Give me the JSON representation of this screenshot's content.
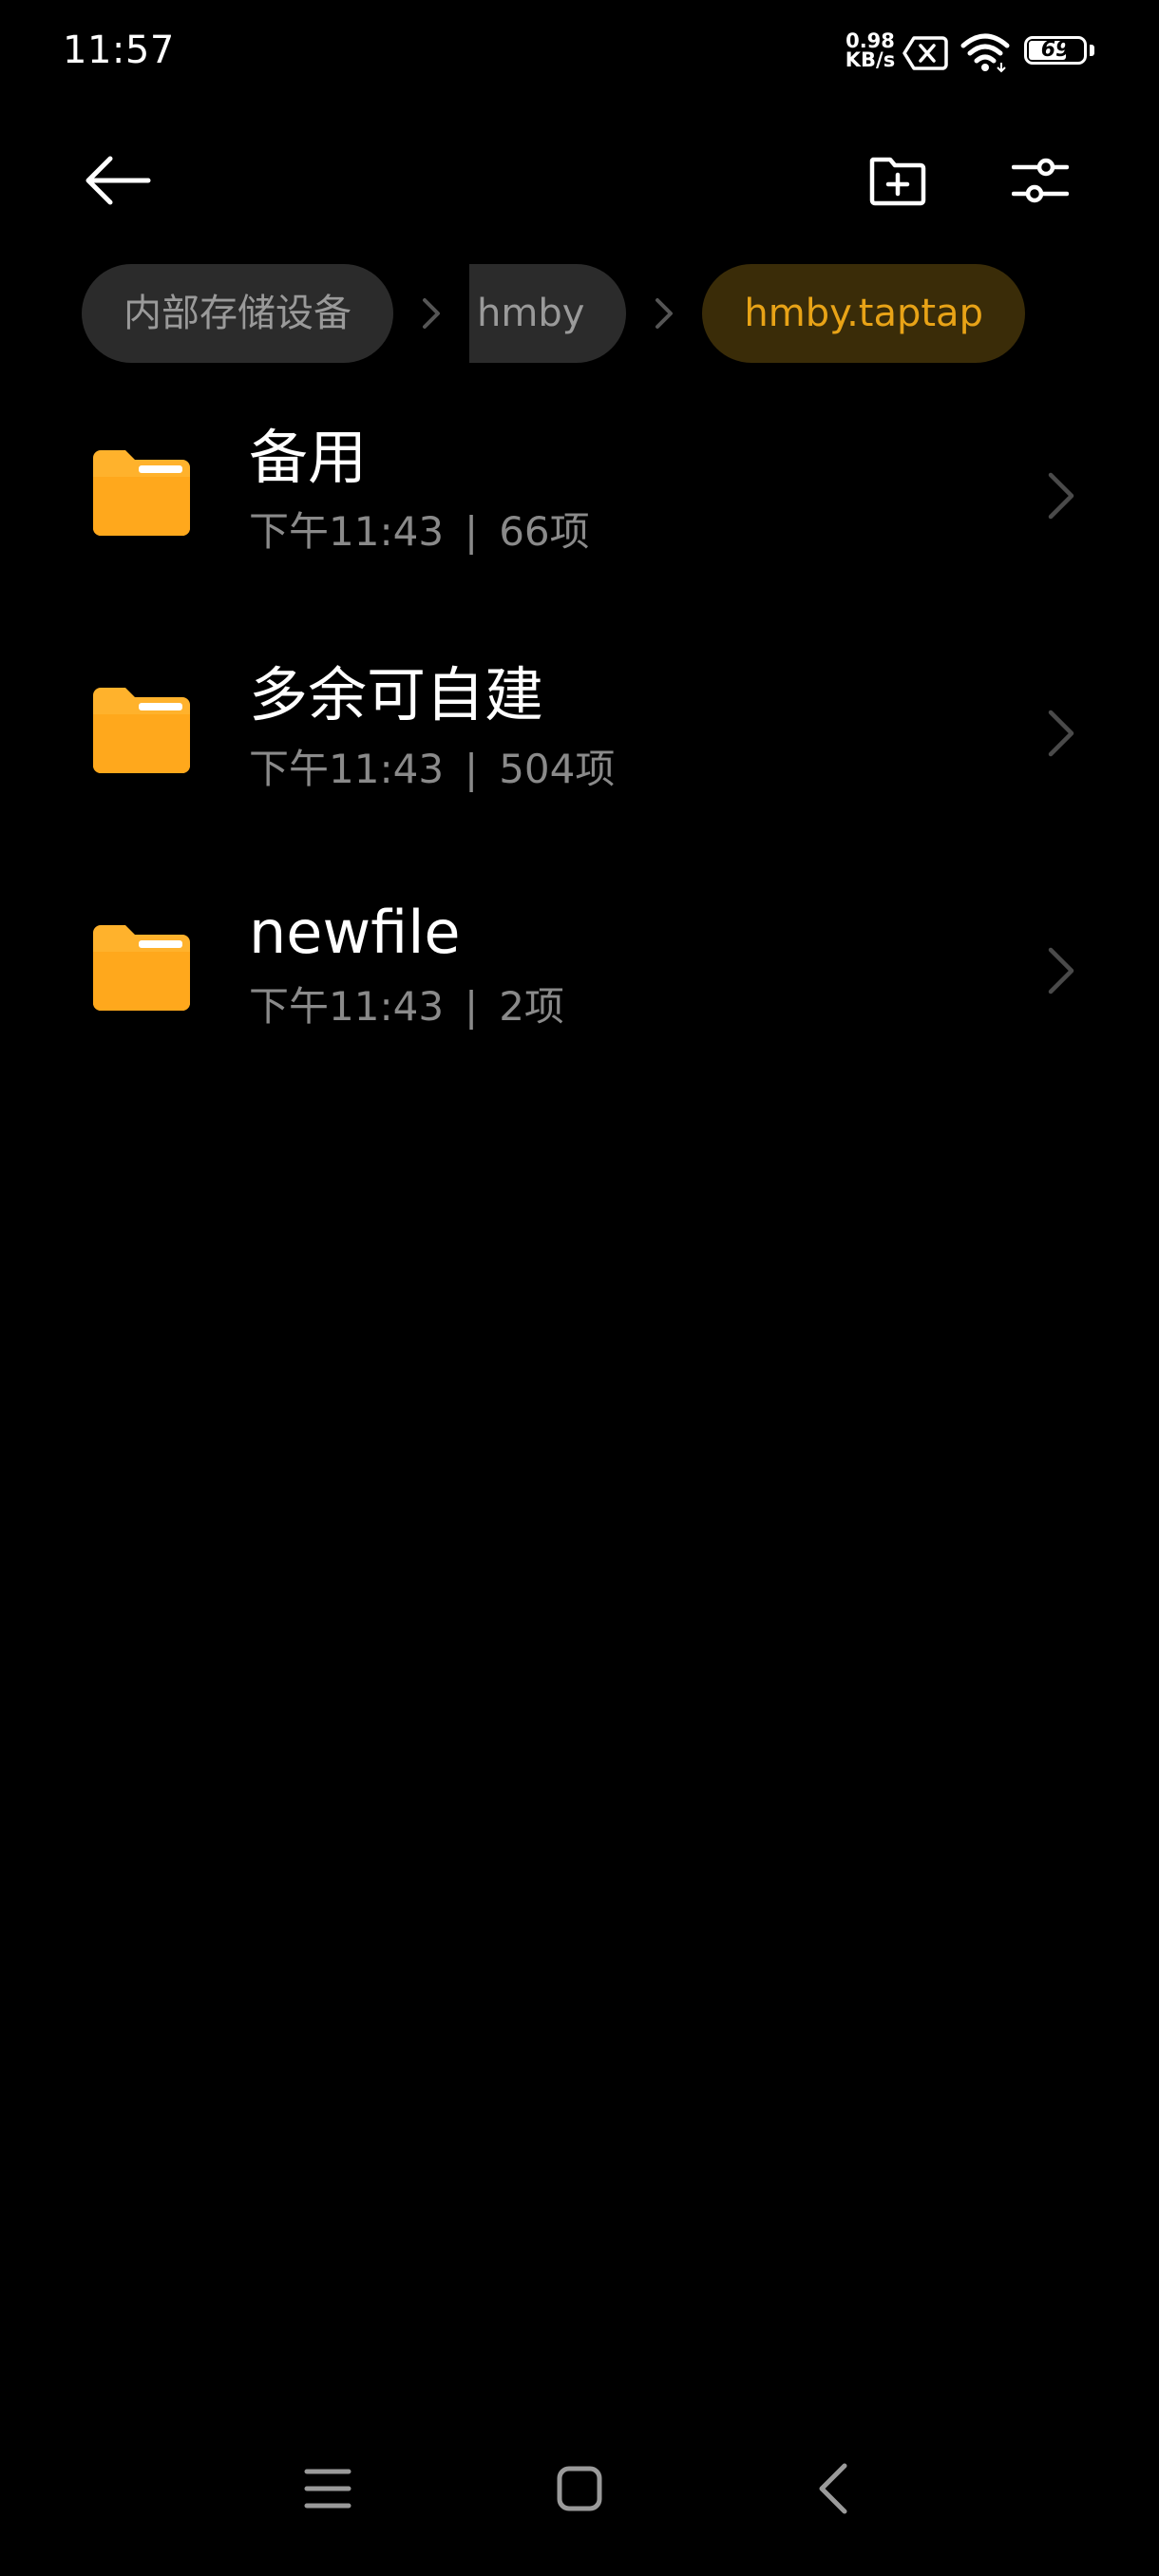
{
  "status_bar": {
    "time": "11:57",
    "net_speed_value": "0.98",
    "net_speed_unit": "KB/s",
    "battery_level": "69",
    "battery_fraction": 0.69,
    "icons": [
      "sim-disabled-icon",
      "wifi-icon",
      "battery-icon"
    ]
  },
  "toolbar": {
    "back_icon": "arrow-left-icon",
    "new_folder_icon": "folder-plus-icon",
    "filter_icon": "sliders-icon"
  },
  "breadcrumb": {
    "items": [
      "内部存储设备",
      "hmby",
      "hmby.taptap"
    ],
    "active_index": 2
  },
  "files": [
    {
      "name": "备用",
      "time": "下午11:43",
      "count": "66项"
    },
    {
      "name": "多余可自建",
      "time": "下午11:43",
      "count": "504项"
    },
    {
      "name": "newfile",
      "time": "下午11:43",
      "count": "2项"
    }
  ],
  "meta_separator": "|",
  "colors": {
    "background": "#000000",
    "folder": "#ffb22c",
    "accent": "#e8a317",
    "pill": "#2b2b2b",
    "secondary_text": "#8a8a8a"
  },
  "nav_bar": {
    "icons": [
      "menu-icon",
      "home-square-icon",
      "back-chevron-icon"
    ]
  }
}
